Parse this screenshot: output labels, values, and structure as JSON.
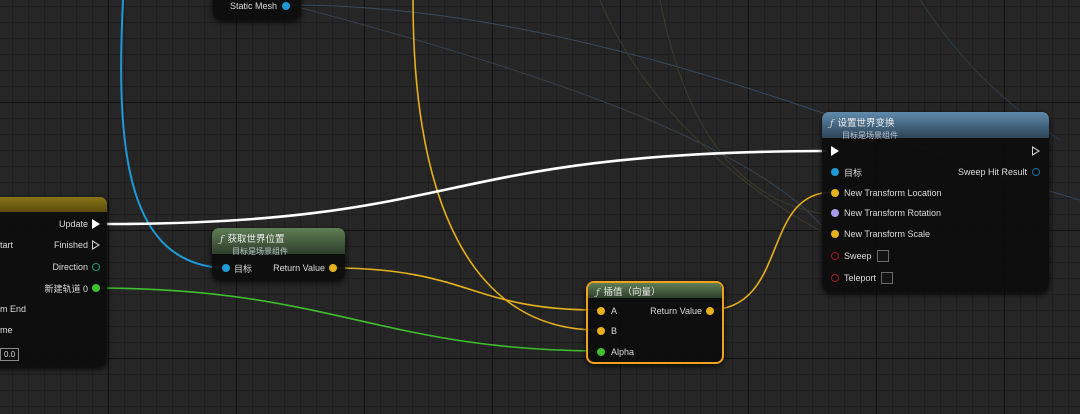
{
  "static_mesh_node": {
    "pin_label": "Static Mesh"
  },
  "timeline_node": {
    "pins": {
      "start": "tart",
      "update": "Update",
      "finished": "Finished",
      "direction": "Direction",
      "track": "新建轨道 0",
      "from_end": "m End",
      "new_time": "me",
      "time_value": "0.0"
    }
  },
  "get_world_location_node": {
    "title": "获取世界位置",
    "subtitle": "目标是场景组件",
    "target": "目标",
    "return_value": "Return Value"
  },
  "lerp_vector_node": {
    "title": "插值（向量）",
    "a": "A",
    "b": "B",
    "alpha": "Alpha",
    "return_value": "Return Value"
  },
  "set_world_transform_node": {
    "title": "设置世界变换",
    "subtitle": "目标是场景组件",
    "target": "目标",
    "sweep_hit_result": "Sweep Hit Result",
    "location": "New Transform Location",
    "rotation": "New Transform Rotation",
    "scale": "New Transform Scale",
    "sweep": "Sweep",
    "teleport": "Teleport"
  },
  "colors": {
    "exec_wire": "#ffffff",
    "object_wire": "#1e9ad6",
    "vector_wire": "#e6b11c",
    "float_wire": "#3fbf2e",
    "function_header_green": "#4f6b47",
    "function_header_blue": "#4a6f8c",
    "selected_outline": "#f0a21e"
  },
  "icons": [
    "function-icon",
    "exec-pin-icon",
    "object-pin-icon",
    "vector-pin-icon",
    "float-pin-icon",
    "rotator-pin-icon",
    "bool-pin-icon",
    "struct-pin-icon"
  ]
}
